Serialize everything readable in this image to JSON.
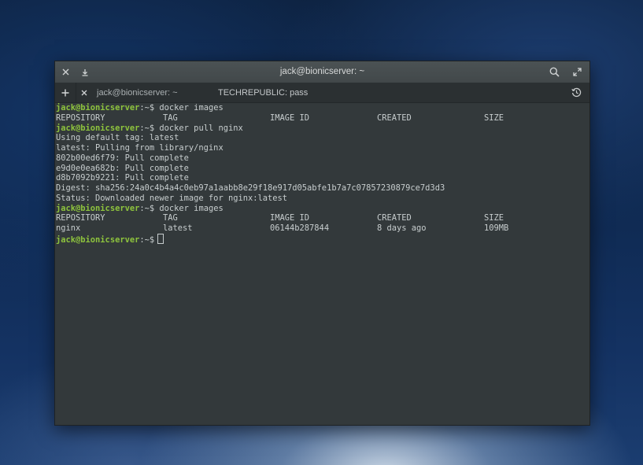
{
  "window": {
    "title": "jack@bionicserver: ~"
  },
  "tabs": [
    {
      "label": "jack@bionicserver: ~",
      "active": true
    },
    {
      "label": "TECHREPUBLIC: pass",
      "active": false
    }
  ],
  "colors": {
    "prompt": "#8ec43d",
    "terminal_bg": "#33393b",
    "text": "#c7cdce"
  },
  "terminal": {
    "prompt_user": "jack@bionicserver",
    "prompt_suffix": ":~$",
    "cmd1": " docker images",
    "header": {
      "repo": "REPOSITORY",
      "tag": "TAG",
      "id": "IMAGE ID",
      "created": "CREATED",
      "size": "SIZE"
    },
    "cmd2": " docker pull nginx",
    "pull_output": [
      "Using default tag: latest",
      "latest: Pulling from library/nginx",
      "802b00ed6f79: Pull complete",
      "e9d0e0ea682b: Pull complete",
      "d8b7092b9221: Pull complete",
      "Digest: sha256:24a0c4b4a4c0eb97a1aabb8e29f18e917d05abfe1b7a7c07857230879ce7d3d3",
      "Status: Downloaded newer image for nginx:latest"
    ],
    "cmd3": " docker images",
    "row": {
      "repo": "nginx",
      "tag": "latest",
      "id": "06144b287844",
      "created": "8 days ago",
      "size": "109MB"
    }
  }
}
